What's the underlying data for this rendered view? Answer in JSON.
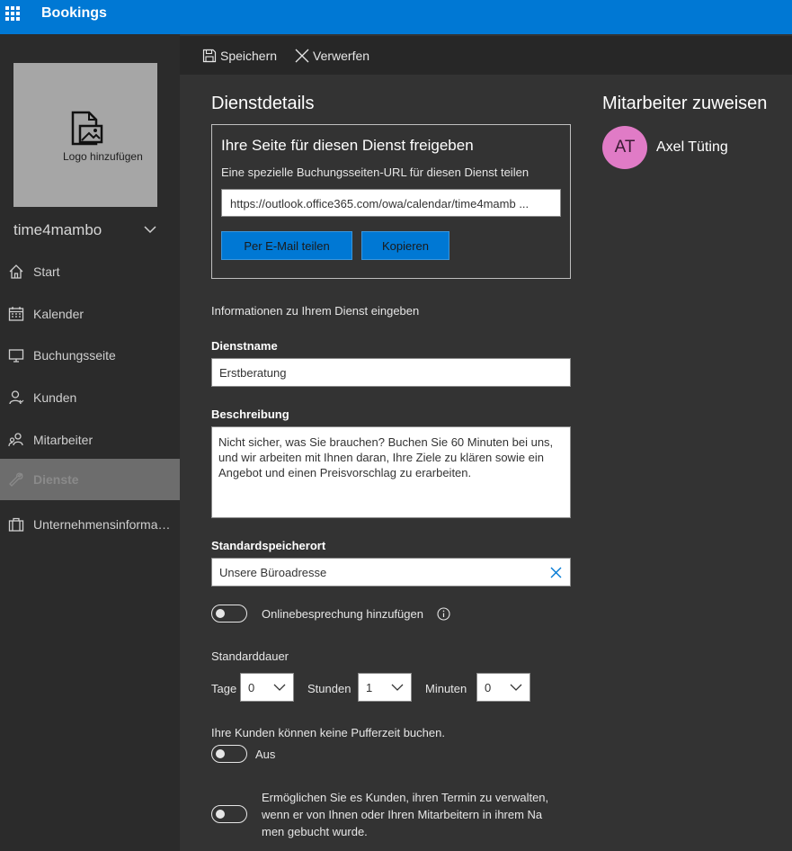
{
  "app": {
    "title": "Bookings"
  },
  "sidebar": {
    "logo_label": "Logo hinzufügen",
    "business_name": "time4mambo",
    "items": [
      {
        "label": "Start",
        "icon": "home-icon"
      },
      {
        "label": "Kalender",
        "icon": "calendar-icon"
      },
      {
        "label": "Buchungsseite",
        "icon": "monitor-icon"
      },
      {
        "label": "Kunden",
        "icon": "person-icon"
      },
      {
        "label": "Mitarbeiter",
        "icon": "people-icon"
      },
      {
        "label": "Dienste",
        "icon": "wrench-icon",
        "active": true
      },
      {
        "label": "Unternehmensinforma…",
        "icon": "briefcase-icon"
      }
    ]
  },
  "toolbar": {
    "save_label": "Speichern",
    "discard_label": "Verwerfen"
  },
  "service": {
    "heading": "Dienstdetails",
    "share": {
      "title": "Ihre Seite für diesen Dienst freigeben",
      "subtitle": "Eine spezielle Buchungsseiten-URL für diesen Dienst teilen",
      "url": "https://outlook.office365.com/owa/calendar/time4mamb ...",
      "email_button": "Per E-Mail teilen",
      "copy_button": "Kopieren"
    },
    "intro": "Informationen zu Ihrem Dienst eingeben",
    "name_label": "Dienstname",
    "name_value": "Erstberatung",
    "description_label": "Beschreibung",
    "description_value": "Nicht sicher, was Sie brauchen? Buchen Sie 60 Minuten bei uns, und wir arbeiten mit Ihnen daran, Ihre Ziele zu klären sowie ein Angebot und einen Preisvorschlag zu erarbeiten.",
    "location_label": "Standardspeicherort",
    "location_value": "Unsere Büroadresse",
    "online_meeting_label": "Onlinebesprechung hinzufügen",
    "online_meeting_on": false,
    "duration_label": "Standarddauer",
    "days_label": "Tage",
    "days_value": "0",
    "hours_label": "Stunden",
    "hours_value": "1",
    "minutes_label": "Minuten",
    "minutes_value": "0",
    "buffer_text": "Ihre Kunden können keine Pufferzeit buchen.",
    "buffer_state": "Aus",
    "buffer_on": false,
    "manage_text_1": "Ermöglichen Sie es Kunden, ihren Termin zu verwalten,",
    "manage_text_2": "wenn er von Ihnen oder Ihren Mitarbeitern in ihrem Na",
    "manage_text_3": "men gebucht wurde.",
    "manage_on": false
  },
  "staff": {
    "heading": "Mitarbeiter zuweisen",
    "members": [
      {
        "initials": "AT",
        "name": "Axel Tüting",
        "color": "#e07bc6"
      }
    ]
  },
  "colors": {
    "accent": "#0078d4",
    "background": "#333333",
    "sidebar": "#2b2b2b"
  }
}
